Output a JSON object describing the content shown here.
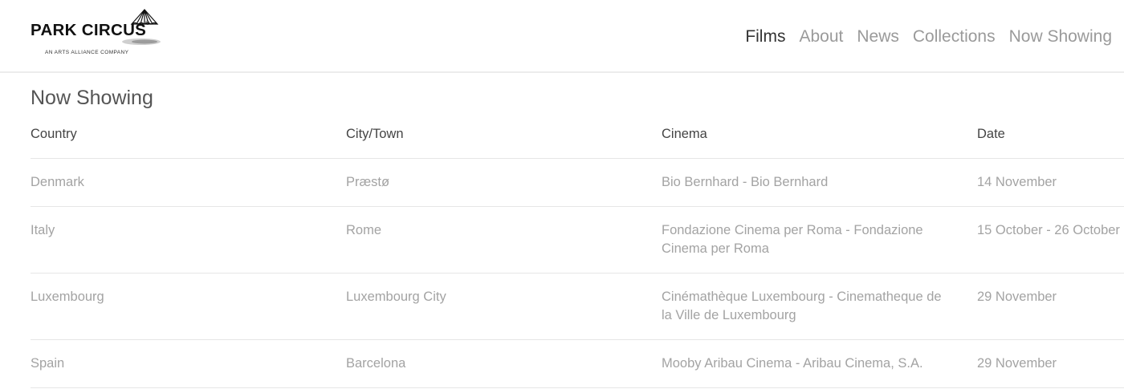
{
  "header": {
    "logo": {
      "brand": "PARK CIRCUS",
      "registered_mark": "®",
      "tagline": "AN ARTS ALLIANCE COMPANY"
    },
    "nav": [
      {
        "label": "Films",
        "active": true
      },
      {
        "label": "About",
        "active": false
      },
      {
        "label": "News",
        "active": false
      },
      {
        "label": "Collections",
        "active": false
      },
      {
        "label": "Now Showing",
        "active": false
      }
    ]
  },
  "main": {
    "title": "Now Showing",
    "table": {
      "columns": [
        "Country",
        "City/Town",
        "Cinema",
        "Date"
      ],
      "rows": [
        {
          "country": "Denmark",
          "city": "Præstø",
          "cinema": "Bio Bernhard - Bio Bernhard",
          "date": "14 November"
        },
        {
          "country": "Italy",
          "city": "Rome",
          "cinema": "Fondazione Cinema per Roma - Fondazione Cinema per Roma",
          "date": "15 October - 26 October"
        },
        {
          "country": "Luxembourg",
          "city": "Luxembourg City",
          "cinema": "Cinémathèque Luxembourg - Cinematheque de la Ville de Luxembourg",
          "date": "29 November"
        },
        {
          "country": "Spain",
          "city": "Barcelona",
          "cinema": "Mooby Aribau Cinema - Aribau Cinema, S.A.",
          "date": "29 November"
        }
      ]
    }
  },
  "colors": {
    "nav_active": "#333333",
    "nav_inactive": "#9a9a9a",
    "table_header_text": "#444444",
    "table_cell_text": "#a3a3a3",
    "divider": "#e6e6e6"
  }
}
